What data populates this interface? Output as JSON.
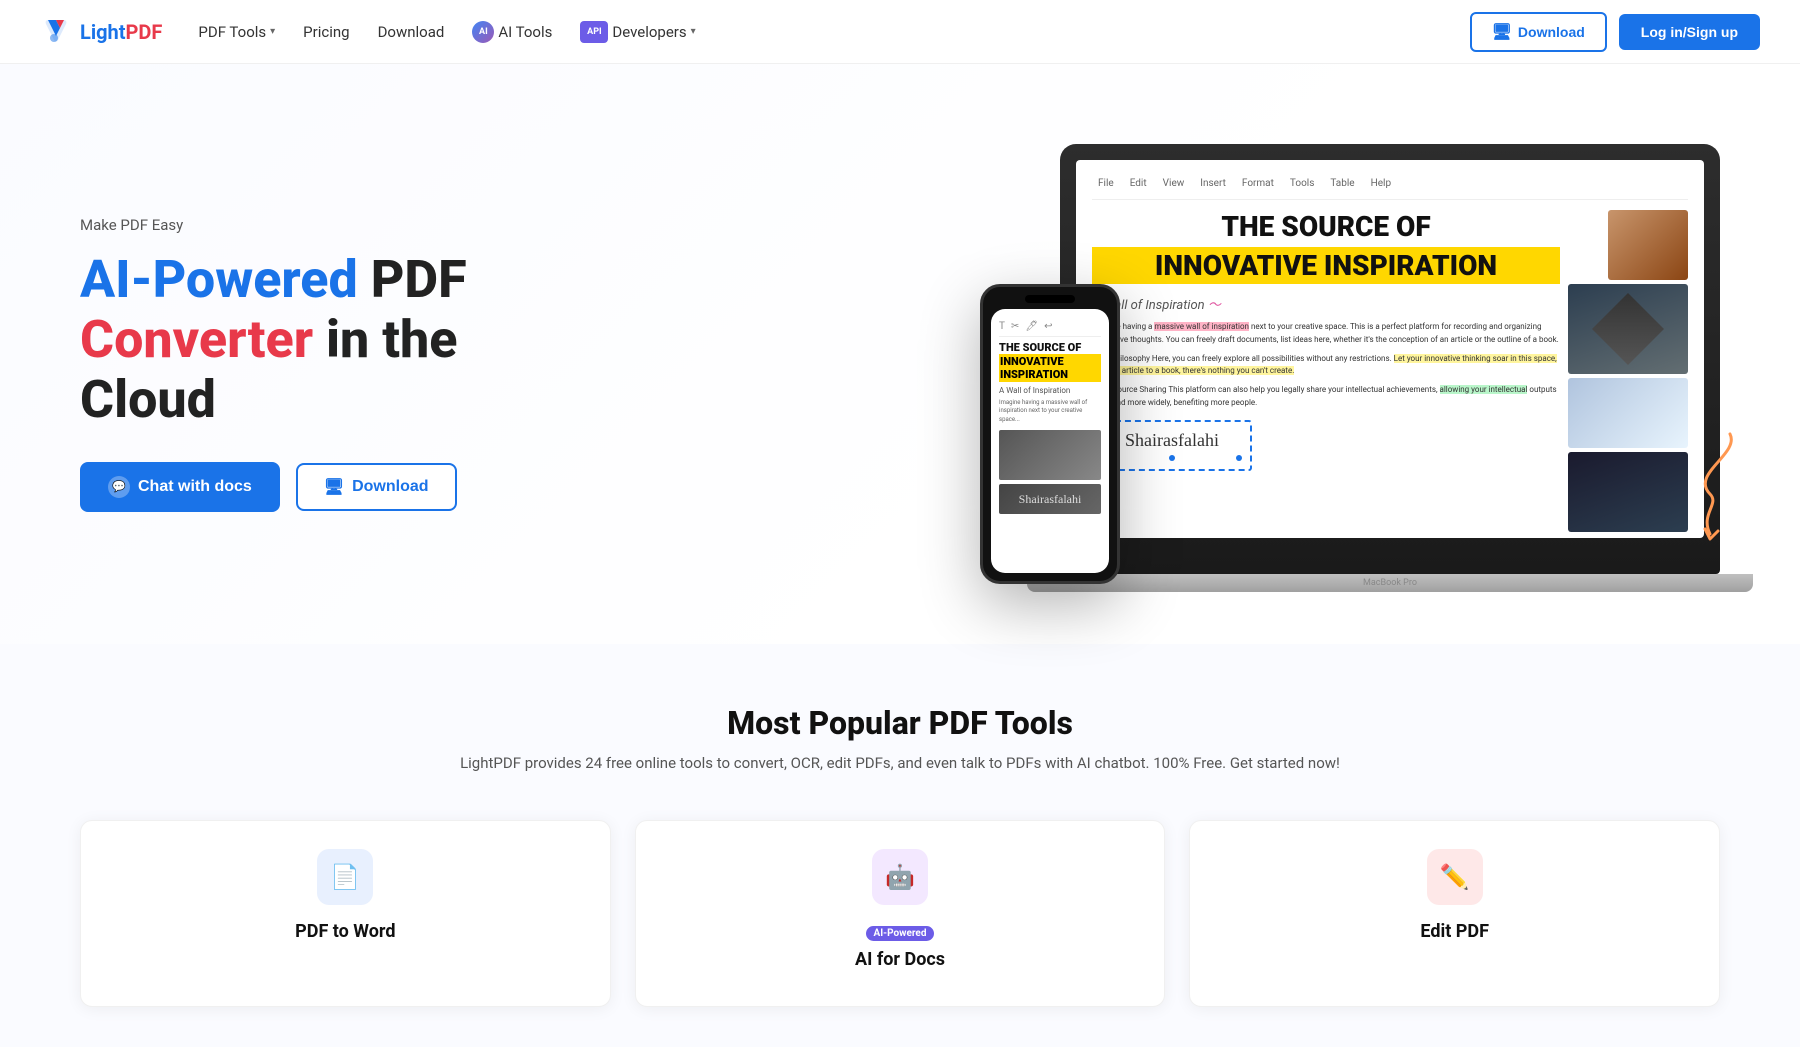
{
  "brand": {
    "name_part1": "Light",
    "name_part2": "PDF",
    "logo_alt": "LightPDF logo"
  },
  "nav": {
    "pdf_tools_label": "PDF Tools",
    "pricing_label": "Pricing",
    "download_label": "Download",
    "ai_tools_label": "AI Tools",
    "developers_label": "Developers",
    "btn_download_label": "Download",
    "btn_login_label": "Log in/Sign up"
  },
  "hero": {
    "tagline": "Make PDF Easy",
    "title_blue": "AI-Powered",
    "title_black1": " PDF",
    "title_red": "Converter",
    "title_black2": " in the Cloud",
    "btn_chat": "Chat with docs",
    "btn_download": "Download"
  },
  "pdf_preview": {
    "main_title": "THE SOURCE OF",
    "highlight_title": "INNOVATIVE INSPIRATION",
    "subtitle": "A Wall of Inspiration",
    "toolbar_items": [
      "File",
      "Edit",
      "View",
      "Insert",
      "Format",
      "Tools",
      "Table",
      "Help"
    ],
    "text1": "Imagine having a massive wall of inspiration next to your creative space. This is a perfect platform for recording and organizing innovative thoughts. You can freely draft documents, list ideas here, whether it's the conception of an article or the outline of a book.",
    "text2": "Core Philosophy Here, you can freely explore all possibilities without any restrictions. Let your innovative thinking soar in this space, from an article to a book, there's nothing you can't create.",
    "text3": "Open Source Sharing This platform can also help you legally share your intellectual achievements, allowing your intellectual outputs to spread more widely, benefiting more people.",
    "signature": "Shairasfalahi"
  },
  "tools_section": {
    "title": "Most Popular PDF Tools",
    "subtitle": "LightPDF provides 24 free online tools to convert, OCR, edit PDFs, and even talk to PDFs with AI chatbot. 100% Free. Get started now!",
    "cards": [
      {
        "title": "PDF to Word",
        "icon": "📄",
        "icon_class": "icon-blue",
        "ai_powered": false
      },
      {
        "title": "AI for Docs",
        "icon": "🤖",
        "icon_class": "icon-purple",
        "ai_powered": true
      },
      {
        "title": "Edit PDF",
        "icon": "✏️",
        "icon_class": "icon-red",
        "ai_powered": false
      }
    ]
  }
}
